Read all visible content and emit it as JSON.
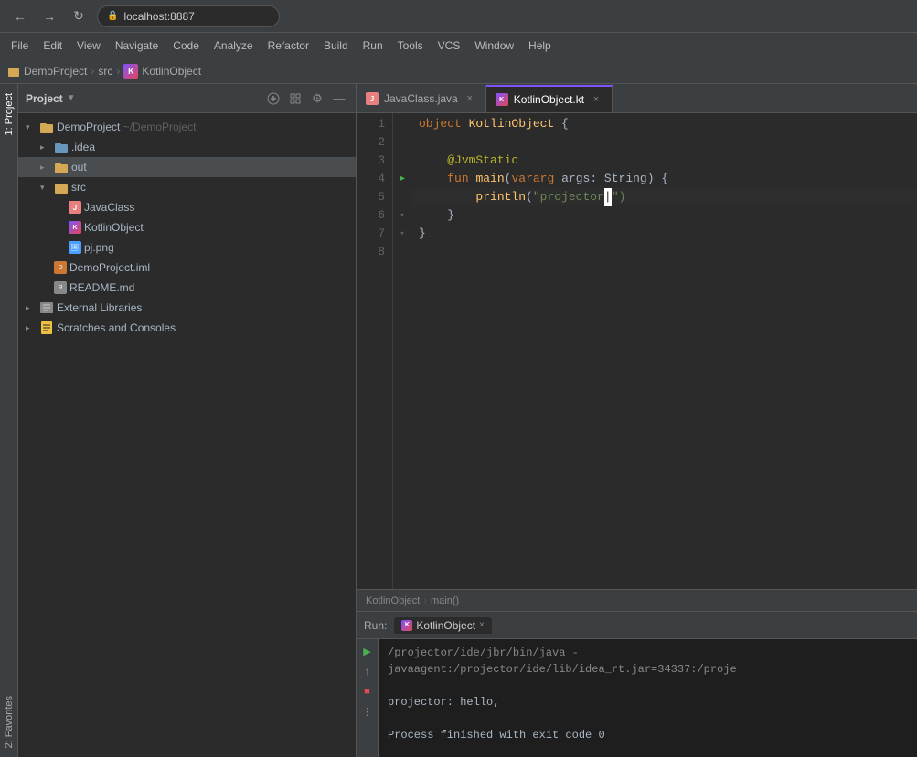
{
  "browser": {
    "url": "localhost:8887",
    "back_label": "←",
    "forward_label": "→",
    "reload_label": "↻"
  },
  "menubar": {
    "items": [
      "File",
      "Edit",
      "View",
      "Navigate",
      "Code",
      "Analyze",
      "Refactor",
      "Build",
      "Run",
      "Tools",
      "VCS",
      "Window",
      "Help"
    ]
  },
  "breadcrumb": {
    "project": "DemoProject",
    "src": "src",
    "file": "KotlinObject"
  },
  "panel": {
    "title": "Project",
    "caret": "▼",
    "add_label": "+",
    "settings_label": "⚙",
    "minimize_label": "—"
  },
  "tree": {
    "items": [
      {
        "id": "demoproject",
        "label": "DemoProject ~/DemoProject",
        "indent": 1,
        "type": "root",
        "state": "expanded"
      },
      {
        "id": "idea",
        "label": ".idea",
        "indent": 2,
        "type": "folder-blue",
        "state": "collapsed"
      },
      {
        "id": "out",
        "label": "out",
        "indent": 2,
        "type": "folder",
        "state": "collapsed",
        "selected": true
      },
      {
        "id": "src",
        "label": "src",
        "indent": 2,
        "type": "folder",
        "state": "expanded"
      },
      {
        "id": "javaclass",
        "label": "JavaClass",
        "indent": 3,
        "type": "java"
      },
      {
        "id": "kotlinobject",
        "label": "KotlinObject",
        "indent": 3,
        "type": "kotlin"
      },
      {
        "id": "pjpng",
        "label": "pj.png",
        "indent": 3,
        "type": "png"
      },
      {
        "id": "demoproject-iml",
        "label": "DemoProject.iml",
        "indent": 2,
        "type": "iml"
      },
      {
        "id": "readme",
        "label": "README.md",
        "indent": 2,
        "type": "md"
      },
      {
        "id": "extlibs",
        "label": "External Libraries",
        "indent": 1,
        "type": "ext-lib",
        "state": "collapsed"
      },
      {
        "id": "scratches",
        "label": "Scratches and Consoles",
        "indent": 1,
        "type": "scratch",
        "state": "collapsed"
      }
    ]
  },
  "tabs": [
    {
      "id": "javaclass-tab",
      "label": "JavaClass.java",
      "icon": "java",
      "active": false
    },
    {
      "id": "kotlinobject-tab",
      "label": "KotlinObject.kt",
      "icon": "kotlin",
      "active": true
    }
  ],
  "code": {
    "lines": [
      {
        "num": 1,
        "content": "object KotlinObject {",
        "tokens": [
          {
            "text": "object",
            "class": "kw-keyword"
          },
          {
            "text": " ",
            "class": "kw-plain"
          },
          {
            "text": "KotlinObject",
            "class": "kw-object-name"
          },
          {
            "text": " {",
            "class": "kw-brace"
          }
        ]
      },
      {
        "num": 2,
        "content": "",
        "tokens": []
      },
      {
        "num": 3,
        "content": "    @JvmStatic",
        "tokens": [
          {
            "text": "    ",
            "class": "kw-plain"
          },
          {
            "text": "@JvmStatic",
            "class": "kw-annotation"
          }
        ]
      },
      {
        "num": 4,
        "content": "    fun main(vararg args: String) {",
        "tokens": [
          {
            "text": "    ",
            "class": "kw-plain"
          },
          {
            "text": "fun",
            "class": "kw-keyword"
          },
          {
            "text": " ",
            "class": "kw-plain"
          },
          {
            "text": "main",
            "class": "kw-function"
          },
          {
            "text": "(",
            "class": "kw-plain"
          },
          {
            "text": "vararg",
            "class": "kw-keyword"
          },
          {
            "text": " ",
            "class": "kw-plain"
          },
          {
            "text": "args",
            "class": "kw-param"
          },
          {
            "text": ": ",
            "class": "kw-plain"
          },
          {
            "text": "String",
            "class": "kw-type"
          },
          {
            "text": ") {",
            "class": "kw-plain"
          }
        ]
      },
      {
        "num": 5,
        "content": "        println(\"projector|\")",
        "tokens": [
          {
            "text": "        ",
            "class": "kw-plain"
          },
          {
            "text": "println",
            "class": "kw-function"
          },
          {
            "text": "(",
            "class": "kw-plain"
          },
          {
            "text": "\"projector",
            "class": "kw-string"
          },
          {
            "text": "|",
            "class": "kw-cursor"
          },
          {
            "text": "\")",
            "class": "kw-string"
          }
        ]
      },
      {
        "num": 6,
        "content": "    }",
        "tokens": [
          {
            "text": "    }",
            "class": "kw-plain"
          }
        ]
      },
      {
        "num": 7,
        "content": "}",
        "tokens": [
          {
            "text": "}",
            "class": "kw-plain"
          }
        ]
      },
      {
        "num": 8,
        "content": "",
        "tokens": []
      }
    ]
  },
  "footer": {
    "object": "KotlinObject",
    "method": "main()",
    "sep": "›"
  },
  "run_panel": {
    "label": "Run:",
    "tab_label": "KotlinObject",
    "close_label": "×",
    "output_lines": [
      "/projector/ide/jbr/bin/java -javaagent:/projector/ide/lib/idea_rt.jar=34337:/proje",
      "",
      "projector: hello,",
      "",
      "Process finished with exit code 0"
    ]
  },
  "side_tabs": {
    "top": "1: Project",
    "bottom": "2: Favorites"
  }
}
